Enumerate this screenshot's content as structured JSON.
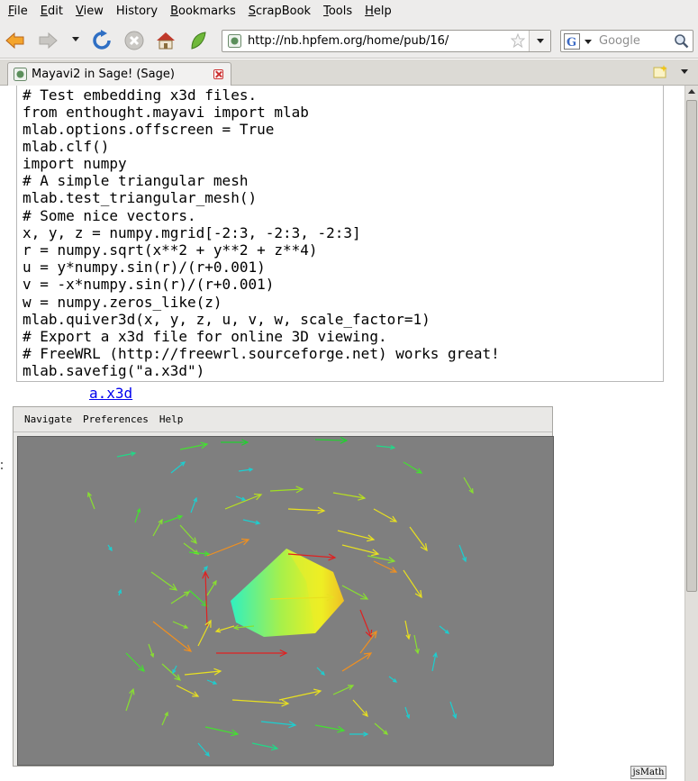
{
  "menubar": {
    "items": [
      {
        "first": "F",
        "rest": "ile"
      },
      {
        "first": "E",
        "rest": "dit"
      },
      {
        "first": "V",
        "rest": "iew"
      },
      {
        "first": "His",
        "rest": "tory",
        "underline_index": 3
      },
      {
        "first": "B",
        "rest": "ookmarks"
      },
      {
        "first": "S",
        "rest": "crapBook"
      },
      {
        "first": "T",
        "rest": "ools"
      },
      {
        "first": "H",
        "rest": "elp"
      }
    ]
  },
  "navbar": {
    "url": "http://nb.hpfem.org/home/pub/16/",
    "search_placeholder": "Google"
  },
  "tab": {
    "title": "Mayavi2 in Sage! (Sage)"
  },
  "code": {
    "lines": [
      "# Test embedding x3d files.",
      "from enthought.mayavi import mlab",
      "mlab.options.offscreen = True",
      "mlab.clf()",
      "import numpy",
      "# A simple triangular mesh",
      "mlab.test_triangular_mesh()",
      "# Some nice vectors.",
      "x, y, z = numpy.mgrid[-2:3, -2:3, -2:3]",
      "r = numpy.sqrt(x**2 + y**2 + z**4)",
      "u = y*numpy.sin(r)/(r+0.001)",
      "v = -x*numpy.sin(r)/(r+0.001)",
      "w = numpy.zeros_like(z)",
      "mlab.quiver3d(x, y, z, u, v, w, scale_factor=1)",
      "# Export a x3d file for online 3D viewing.",
      "# FreeWRL (http://freewrl.sourceforge.net) works great!",
      "mlab.savefig(\"a.x3d\")"
    ]
  },
  "link": {
    "text": "a.x3d"
  },
  "viewer": {
    "menu": [
      "Navigate",
      "Preferences",
      "Help"
    ],
    "background": "#7f7f7f"
  },
  "footer": {
    "jsmath_label": "jsMath"
  }
}
